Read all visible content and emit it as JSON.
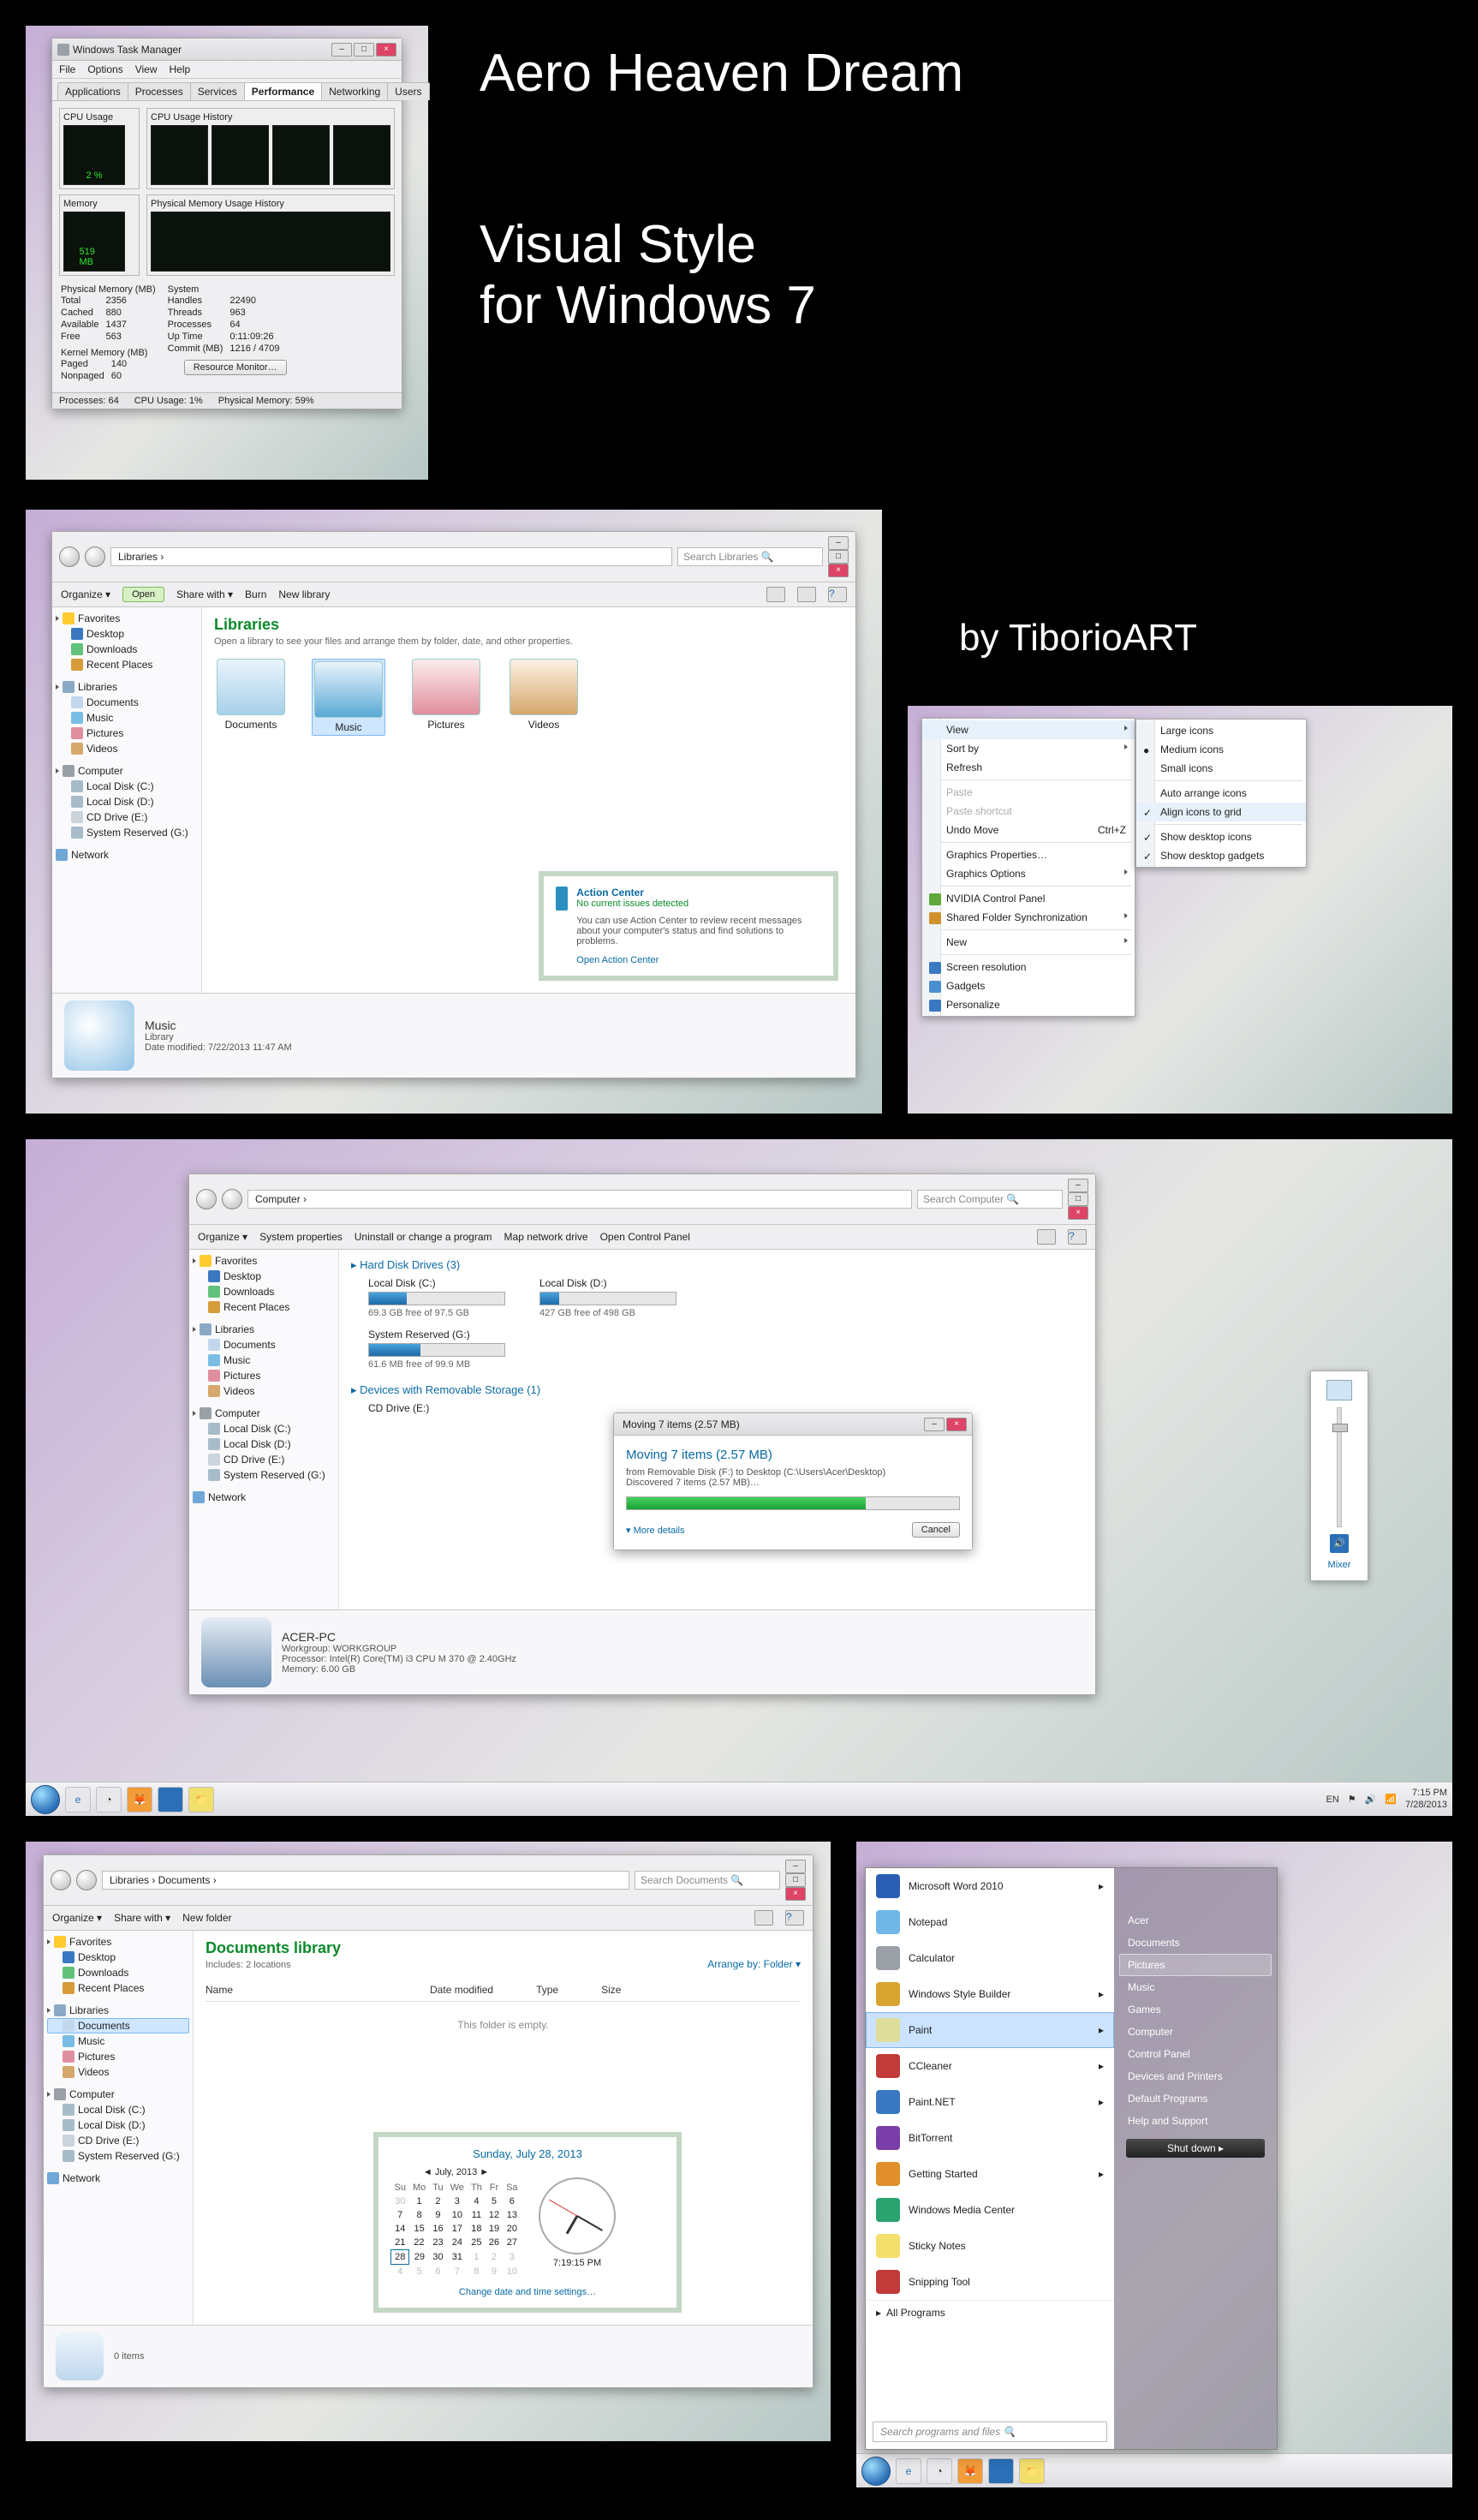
{
  "titles": {
    "h1": "Aero Heaven Dream",
    "h2a": "Visual Style",
    "h2b": "for Windows 7",
    "by": "by TiborioART"
  },
  "tm": {
    "title": "Windows Task Manager",
    "menu": [
      "File",
      "Options",
      "View",
      "Help"
    ],
    "tabs": [
      "Applications",
      "Processes",
      "Services",
      "Performance",
      "Networking",
      "Users"
    ],
    "panels": {
      "cpu": "CPU Usage",
      "cpuHist": "CPU Usage History",
      "mem": "Memory",
      "memHist": "Physical Memory Usage History"
    },
    "cpuPct": "2 %",
    "memVal": "519 MB",
    "physmem": {
      "head": "Physical Memory (MB)",
      "rows": [
        [
          "Total",
          "2356"
        ],
        [
          "Cached",
          "880"
        ],
        [
          "Available",
          "1437"
        ],
        [
          "Free",
          "563"
        ]
      ]
    },
    "kernel": {
      "head": "Kernel Memory (MB)",
      "rows": [
        [
          "Paged",
          "140"
        ],
        [
          "Nonpaged",
          "60"
        ]
      ]
    },
    "system": {
      "head": "System",
      "rows": [
        [
          "Handles",
          "22490"
        ],
        [
          "Threads",
          "963"
        ],
        [
          "Processes",
          "64"
        ],
        [
          "Up Time",
          "0:11:09:26"
        ],
        [
          "Commit (MB)",
          "1216 / 4709"
        ]
      ]
    },
    "resourceBtn": "Resource Monitor…",
    "status": {
      "procs": "Processes: 64",
      "cpu": "CPU Usage: 1%",
      "mem": "Physical Memory: 59%"
    }
  },
  "exp1": {
    "crumb": "Libraries ›",
    "search": "Search Libraries",
    "toolbar": [
      "Organize ▾",
      "Open",
      "Share with ▾",
      "Burn",
      "New library"
    ],
    "nav": {
      "favHead": "Favorites",
      "fav": [
        "Desktop",
        "Downloads",
        "Recent Places"
      ],
      "libHead": "Libraries",
      "lib": [
        "Documents",
        "Music",
        "Pictures",
        "Videos"
      ],
      "compHead": "Computer",
      "comp": [
        "Local Disk (C:)",
        "Local Disk (D:)",
        "CD Drive (E:)",
        "System Reserved (G:)"
      ],
      "net": "Network"
    },
    "header": "Libraries",
    "sub": "Open a library to see your files and arrange them by folder, date, and other properties.",
    "items": [
      "Documents",
      "Music",
      "Pictures",
      "Videos"
    ],
    "action": {
      "title": "Action Center",
      "status": "No current issues detected",
      "body": "You can use Action Center to review recent messages about your computer's status and find solutions to problems.",
      "link": "Open Action Center"
    },
    "details": {
      "name": "Music",
      "type": "Library",
      "mod": "Date modified: 7/22/2013 11:47 AM"
    }
  },
  "ctxMain": {
    "items": [
      {
        "t": "View",
        "sub": true
      },
      {
        "t": "Sort by",
        "sub": true
      },
      {
        "t": "Refresh"
      },
      {
        "sep": true
      },
      {
        "t": "Paste",
        "disabled": true
      },
      {
        "t": "Paste shortcut",
        "disabled": true
      },
      {
        "t": "Undo Move",
        "k": "Ctrl+Z"
      },
      {
        "sep": true
      },
      {
        "t": "Graphics Properties…"
      },
      {
        "t": "Graphics Options",
        "sub": true
      },
      {
        "sep": true
      },
      {
        "t": "NVIDIA Control Panel",
        "ico": "#5fa83a"
      },
      {
        "t": "Shared Folder Synchronization",
        "sub": true,
        "ico": "#d0912c"
      },
      {
        "sep": true
      },
      {
        "t": "New",
        "sub": true
      },
      {
        "sep": true
      },
      {
        "t": "Screen resolution",
        "ico": "#3a78c2"
      },
      {
        "t": "Gadgets",
        "ico": "#4a8fd0"
      },
      {
        "t": "Personalize",
        "ico": "#3a78c2"
      }
    ]
  },
  "ctxView": [
    "Large icons",
    "Medium icons",
    "Small icons",
    "—",
    "Auto arrange icons",
    "Align icons to grid",
    "—",
    "Show desktop icons",
    "Show desktop gadgets"
  ],
  "expComp": {
    "crumb": "Computer ›",
    "search": "Search Computer",
    "toolbar": [
      "Organize ▾",
      "System properties",
      "Uninstall or change a program",
      "Map network drive",
      "Open Control Panel"
    ],
    "groups": {
      "hdd": "Hard Disk Drives (3)",
      "removable": "Devices with Removable Storage (1)"
    },
    "drives": {
      "c": {
        "name": "Local Disk (C:)",
        "free": "69.3 GB free of 97.5 GB"
      },
      "d": {
        "name": "Local Disk (D:)",
        "free": "427 GB free of 498 GB"
      },
      "g": {
        "name": "System Reserved (G:)",
        "free": "61.6 MB free of 99.9 MB"
      },
      "e": {
        "name": "CD Drive (E:)"
      }
    },
    "details": {
      "name": "ACER-PC",
      "workgroup": "Workgroup: WORKGROUP",
      "proc": "Processor: Intel(R) Core(TM) i3 CPU       M 370  @ 2.40GHz",
      "mem": "Memory: 6.00 GB"
    }
  },
  "move": {
    "title": "Moving 7 items (2.57 MB)",
    "header": "Moving 7 items (2.57 MB)",
    "line1": "from Removable Disk (F:) to Desktop (C:\\Users\\Acer\\Desktop)",
    "line2": "Discovered 7 items (2.57 MB)…",
    "more": "More details",
    "cancel": "Cancel"
  },
  "vol": {
    "mixer": "Mixer"
  },
  "taskbar": {
    "lang": "EN",
    "time": "7:15 PM",
    "date": "7/28/2013"
  },
  "datetime": {
    "header": "Sunday, July 28, 2013",
    "month": "July, 2013",
    "dow": [
      "Su",
      "Mo",
      "Tu",
      "We",
      "Th",
      "Fr",
      "Sa"
    ],
    "grid": [
      [
        "30",
        "1",
        "2",
        "3",
        "4",
        "5",
        "6"
      ],
      [
        "7",
        "8",
        "9",
        "10",
        "11",
        "12",
        "13"
      ],
      [
        "14",
        "15",
        "16",
        "17",
        "18",
        "19",
        "20"
      ],
      [
        "21",
        "22",
        "23",
        "24",
        "25",
        "26",
        "27"
      ],
      [
        "28",
        "29",
        "30",
        "31",
        "1",
        "2",
        "3"
      ],
      [
        "4",
        "5",
        "6",
        "7",
        "8",
        "9",
        "10"
      ]
    ],
    "today": "28",
    "time": "7:19:15 PM",
    "link": "Change date and time settings…"
  },
  "expDocs": {
    "crumb": "Libraries › Documents ›",
    "search": "Search Documents",
    "toolbar": [
      "Organize ▾",
      "Share with ▾",
      "New folder"
    ],
    "header": "Documents library",
    "sub": "Includes: 2 locations",
    "arrange": "Arrange by:  Folder ▾",
    "cols": [
      "Name",
      "Date modified",
      "Type",
      "Size"
    ],
    "empty": "This folder is empty.",
    "details": "0 items"
  },
  "sm": {
    "items": [
      {
        "t": "Microsoft Word 2010",
        "c": "#2a5eb2",
        "sub": true
      },
      {
        "t": "Notepad",
        "c": "#6fb7e6"
      },
      {
        "t": "Calculator",
        "c": "#9aa0a6"
      },
      {
        "t": "Windows Style Builder",
        "c": "#d9a530",
        "sub": true
      },
      {
        "t": "Paint",
        "c": "#dede9a",
        "sub": true,
        "sel": true
      },
      {
        "t": "CCleaner",
        "c": "#c23a3a",
        "sub": true
      },
      {
        "t": "Paint.NET",
        "c": "#3a78c2",
        "sub": true
      },
      {
        "t": "BitTorrent",
        "c": "#7a3ea8"
      },
      {
        "t": "Getting Started",
        "c": "#e08f2a",
        "sub": true
      },
      {
        "t": "Windows Media Center",
        "c": "#2aa36f"
      },
      {
        "t": "Sticky Notes",
        "c": "#f3df6b"
      },
      {
        "t": "Snipping Tool",
        "c": "#c23a3a"
      }
    ],
    "all": "All Programs",
    "search": "Search programs and files",
    "right": [
      "Acer",
      "Documents",
      "Pictures",
      "Music",
      "Games",
      "Computer",
      "Control Panel",
      "Devices and Printers",
      "Default Programs",
      "Help and Support"
    ],
    "rightSel": "Pictures",
    "shutdown": "Shut down"
  }
}
